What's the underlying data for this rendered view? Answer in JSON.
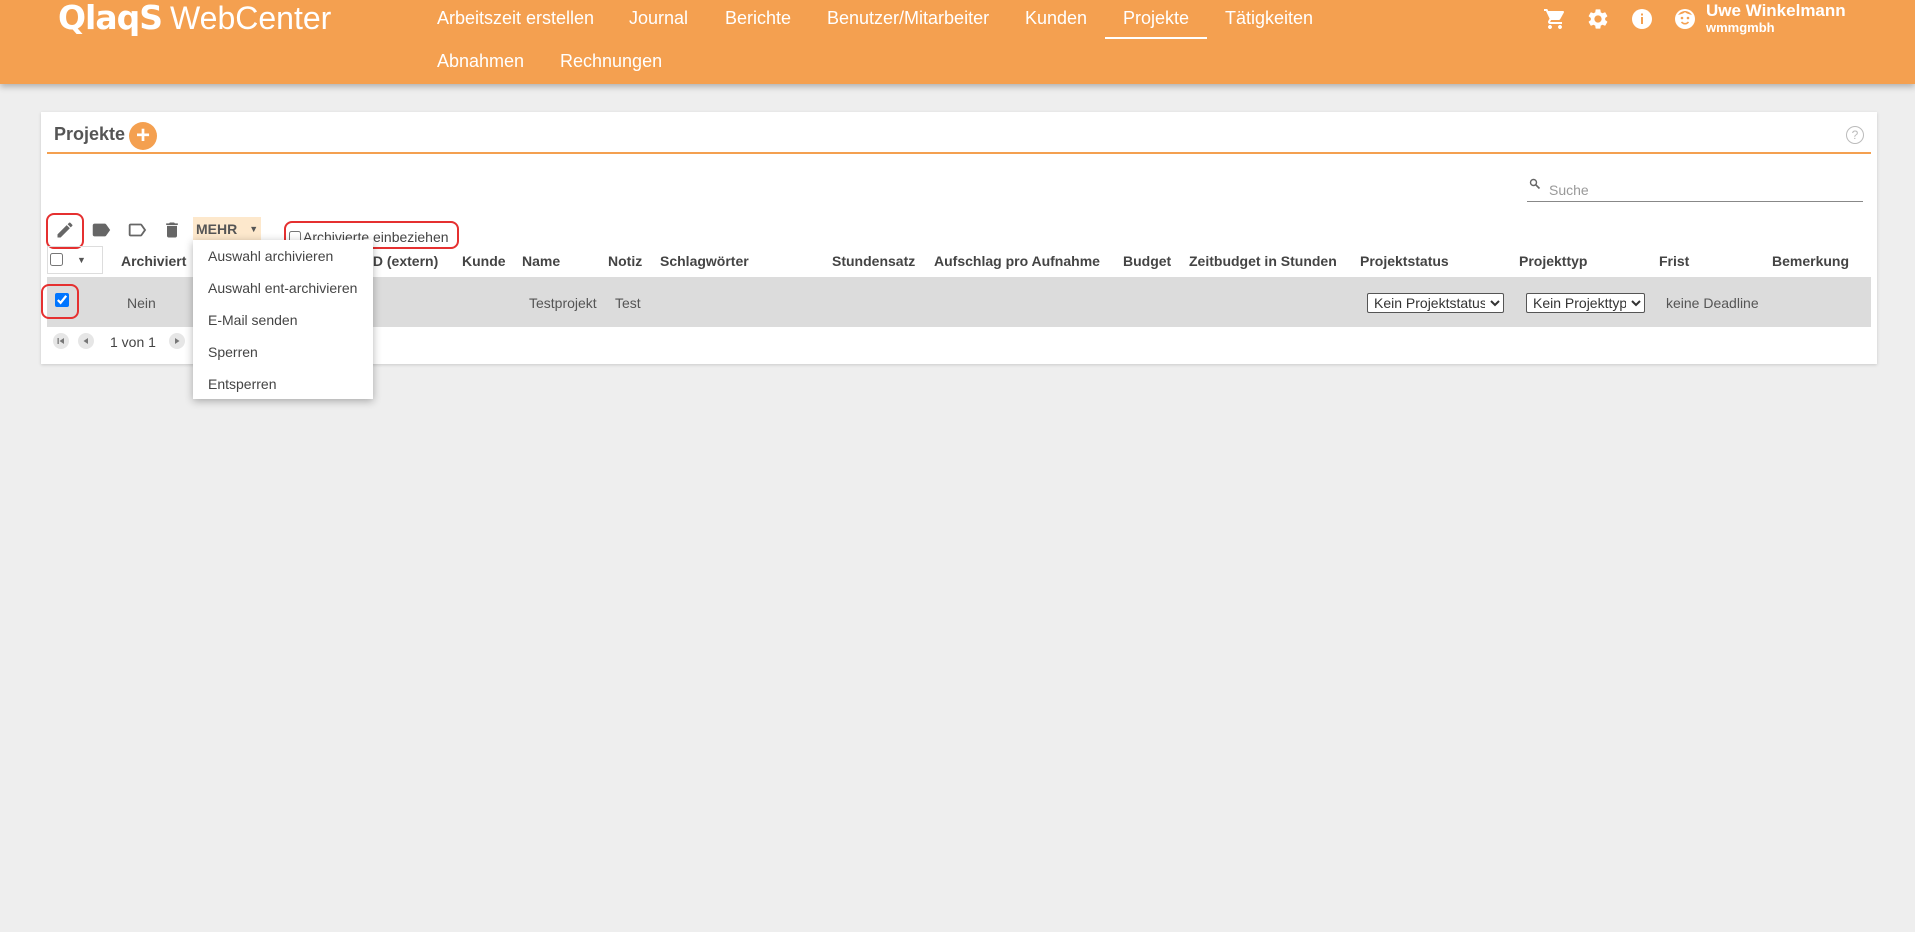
{
  "header": {
    "logo_mark": "QlaqS",
    "logo_text": "WebCenter",
    "nav": [
      {
        "label": "Arbeitszeit erstellen"
      },
      {
        "label": "Journal"
      },
      {
        "label": "Berichte"
      },
      {
        "label": "Benutzer/Mitarbeiter"
      },
      {
        "label": "Kunden"
      },
      {
        "label": "Projekte",
        "active": true
      },
      {
        "label": "Tätigkeiten"
      },
      {
        "label": "Abnahmen"
      },
      {
        "label": "Rechnungen"
      }
    ],
    "icons": [
      "cart-icon",
      "gear-icon",
      "info-icon",
      "user-avatar-icon"
    ],
    "user": {
      "name": "Uwe Winkelmann",
      "org": "wmmgmbh"
    }
  },
  "panel": {
    "title": "Projekte",
    "add_label": "+",
    "help_label": "?",
    "search_placeholder": "Suche",
    "toolbar": {
      "icons": [
        "edit-icon",
        "tag-filled-icon",
        "tag-outline-icon",
        "delete-icon"
      ],
      "more_label": "MEHR",
      "archived_label": "Archivierte einbeziehen",
      "archived_checked": false
    },
    "table": {
      "columns": [
        "Archiviert",
        "ID (extern)",
        "Kunde",
        "Name",
        "Notiz",
        "Schlagwörter",
        "Stundensatz",
        "Aufschlag pro Aufnahme",
        "Budget",
        "Zeitbudget in Stunden",
        "Projektstatus",
        "Projekttyp",
        "Frist",
        "Bemerkung"
      ],
      "rows": [
        {
          "checked": true,
          "archiviert": "Nein",
          "name": "Testprojekt",
          "notiz": "Test",
          "projektstatus": "Kein Projektstatus",
          "projekttyp": "Kein Projekttyp",
          "frist": "keine Deadline"
        }
      ]
    },
    "pager": {
      "text": "1 von 1"
    }
  },
  "more_menu": {
    "items": [
      {
        "label": "Auswahl archivieren"
      },
      {
        "label": "Auswahl ent-archivieren"
      },
      {
        "label": "E-Mail senden"
      },
      {
        "label": "Sperren"
      },
      {
        "label": "Entsperren"
      }
    ]
  },
  "colors": {
    "accent": "#f4a050",
    "highlight": "#e53030",
    "row": "#dcdcdc",
    "background": "#eeeeee"
  }
}
